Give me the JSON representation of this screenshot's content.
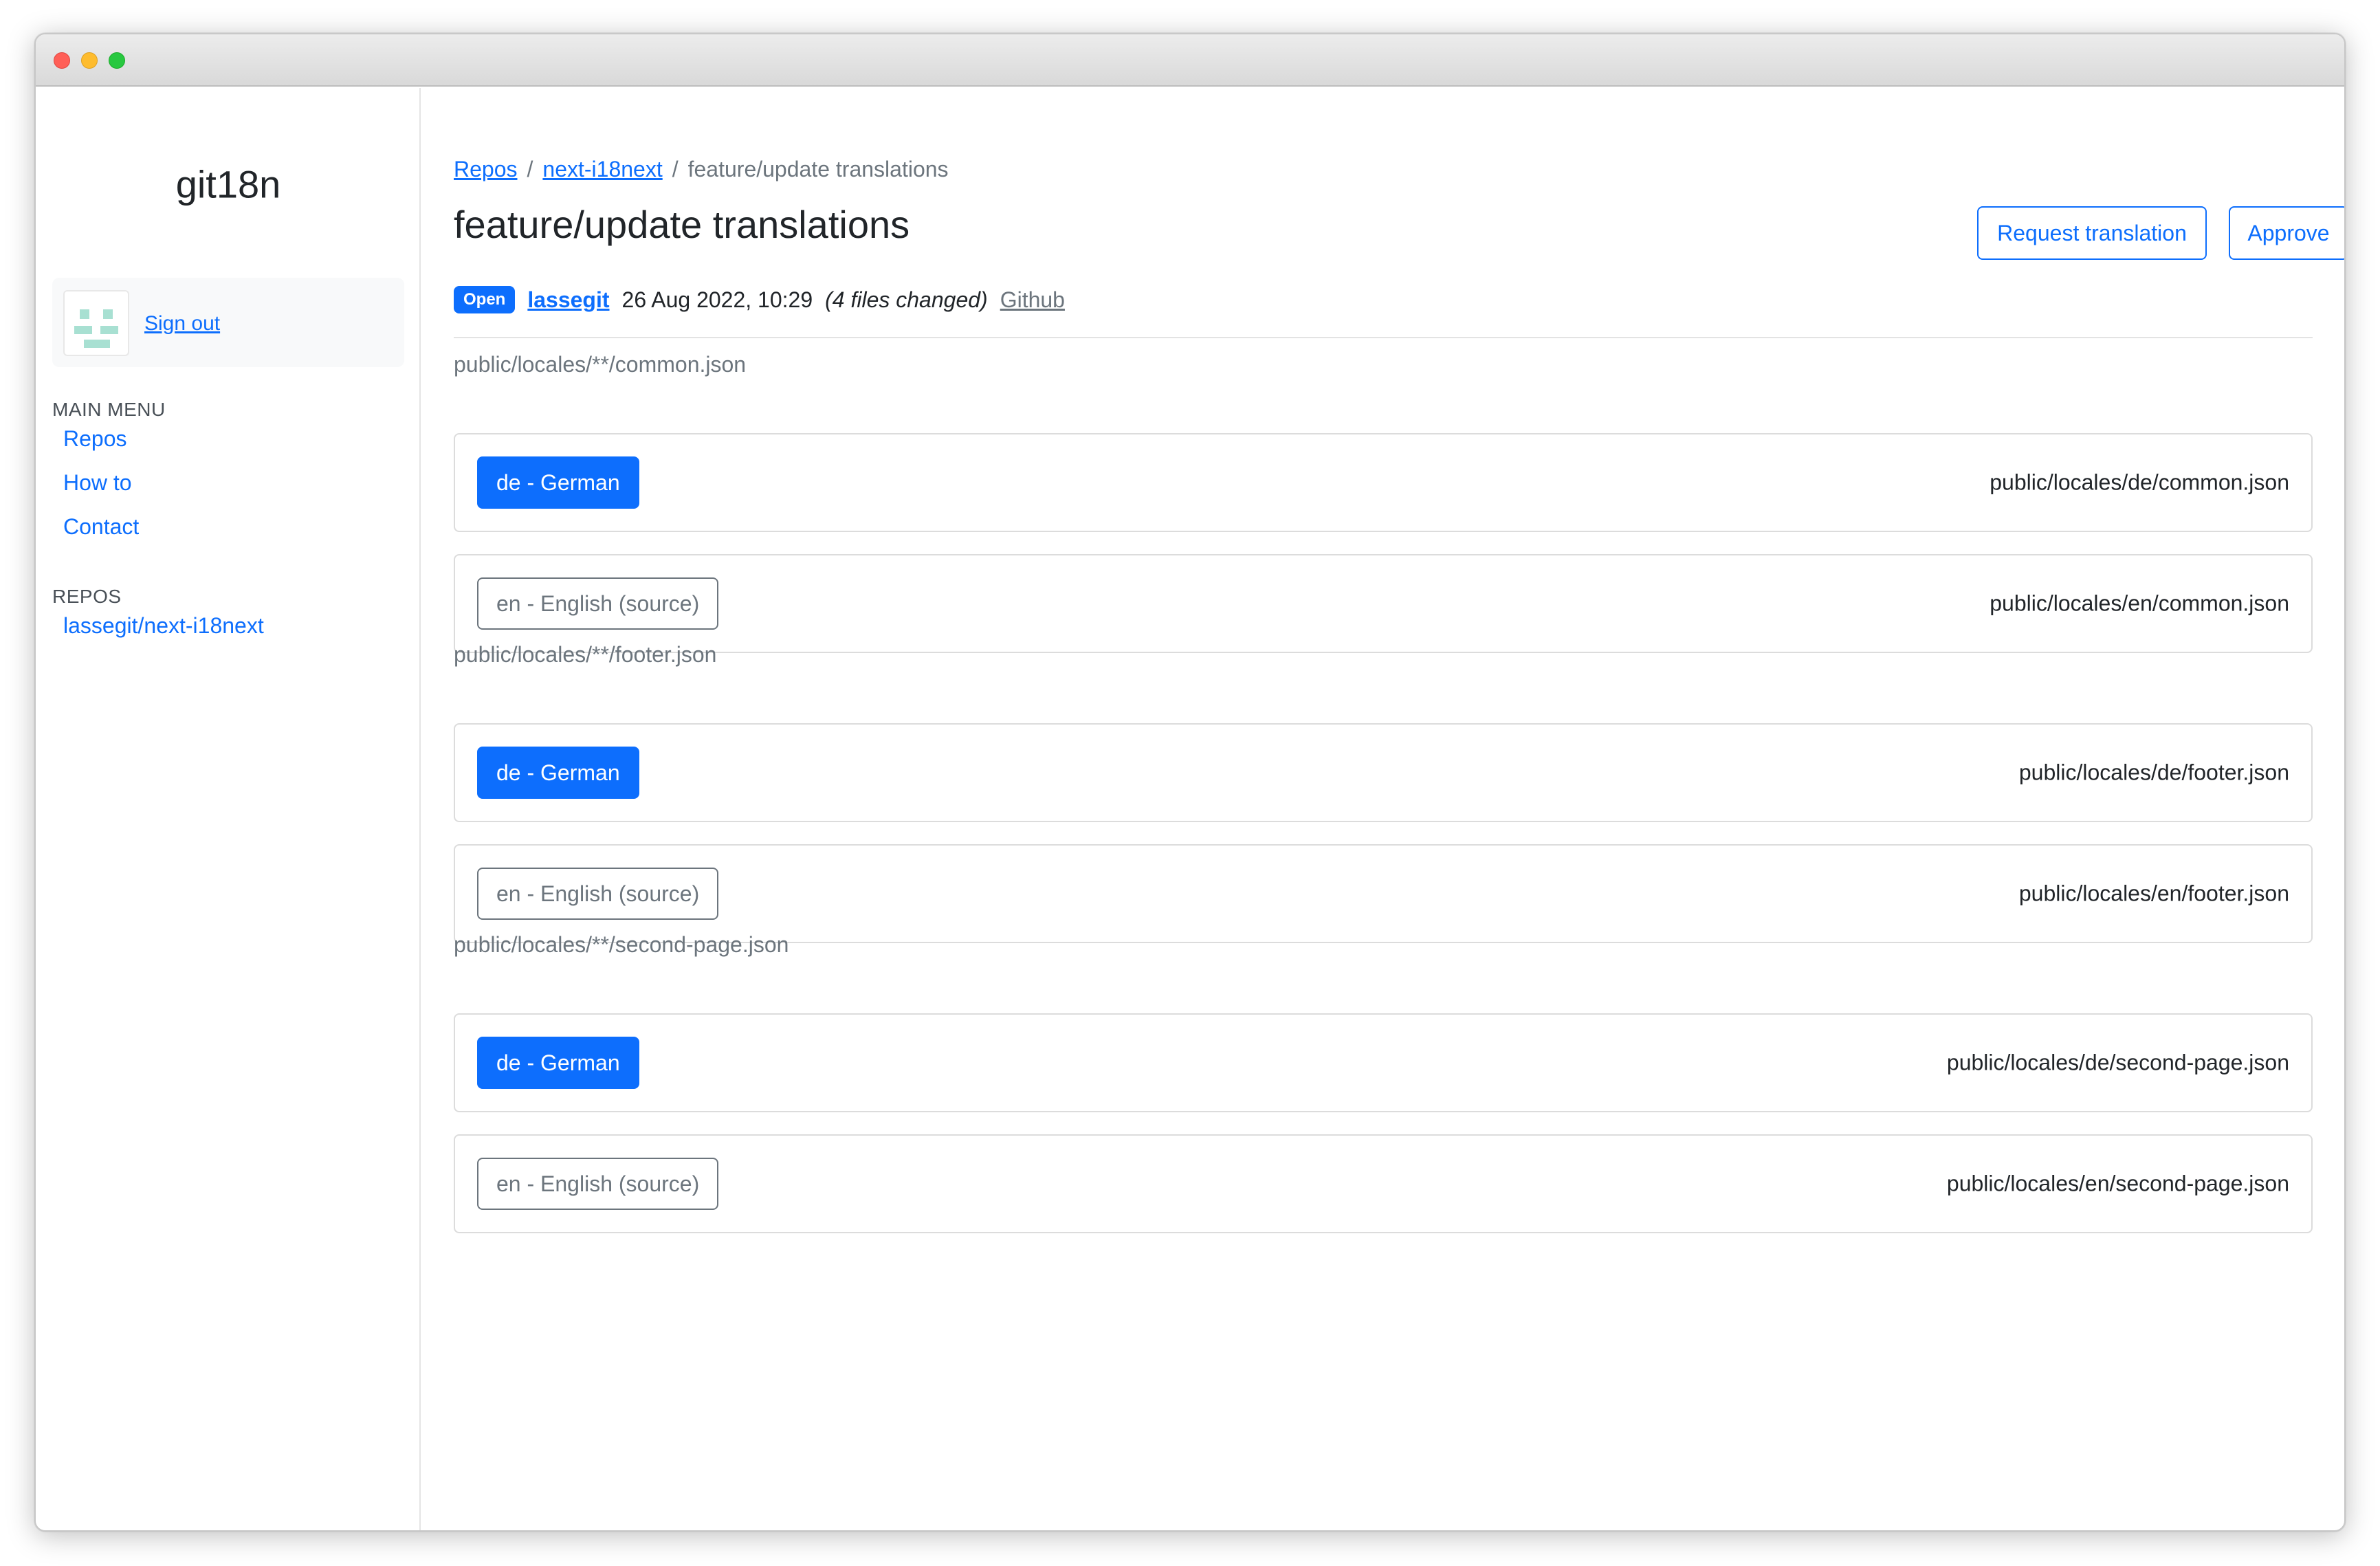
{
  "app": {
    "brand": "git18n"
  },
  "user": {
    "sign_out_label": "Sign out"
  },
  "sidebar": {
    "main_menu_label": "MAIN MENU",
    "main_menu": [
      {
        "label": "Repos"
      },
      {
        "label": "How to"
      },
      {
        "label": "Contact"
      }
    ],
    "repos_label": "REPOS",
    "repos": [
      {
        "label": "lassegit/next-i18next"
      }
    ]
  },
  "breadcrumb": {
    "items": [
      {
        "label": "Repos"
      },
      {
        "label": "next-i18next"
      },
      {
        "label": "feature/update translations"
      }
    ],
    "separator": "/"
  },
  "header": {
    "title": "feature/update translations",
    "request_translation_label": "Request translation",
    "approve_label": "Approve"
  },
  "meta": {
    "status": "Open",
    "author": "lassegit",
    "date": "26 Aug 2022, 10:29",
    "files_changed": "(4 files changed)",
    "github_label": "Github"
  },
  "groups": [
    {
      "pattern": "public/locales/**/common.json",
      "files": [
        {
          "lang": "de - German",
          "path": "public/locales/de/common.json",
          "source": false
        },
        {
          "lang": "en - English (source)",
          "path": "public/locales/en/common.json",
          "source": true
        }
      ]
    },
    {
      "pattern": "public/locales/**/footer.json",
      "files": [
        {
          "lang": "de - German",
          "path": "public/locales/de/footer.json",
          "source": false
        },
        {
          "lang": "en - English (source)",
          "path": "public/locales/en/footer.json",
          "source": true
        }
      ]
    },
    {
      "pattern": "public/locales/**/second-page.json",
      "files": [
        {
          "lang": "de - German",
          "path": "public/locales/de/second-page.json",
          "source": false
        },
        {
          "lang": "en - English (source)",
          "path": "public/locales/en/second-page.json",
          "source": true
        }
      ]
    }
  ],
  "colors": {
    "accent": "#0d6efd",
    "secondary": "#6c757d",
    "avatar": "#a8e0d2"
  }
}
